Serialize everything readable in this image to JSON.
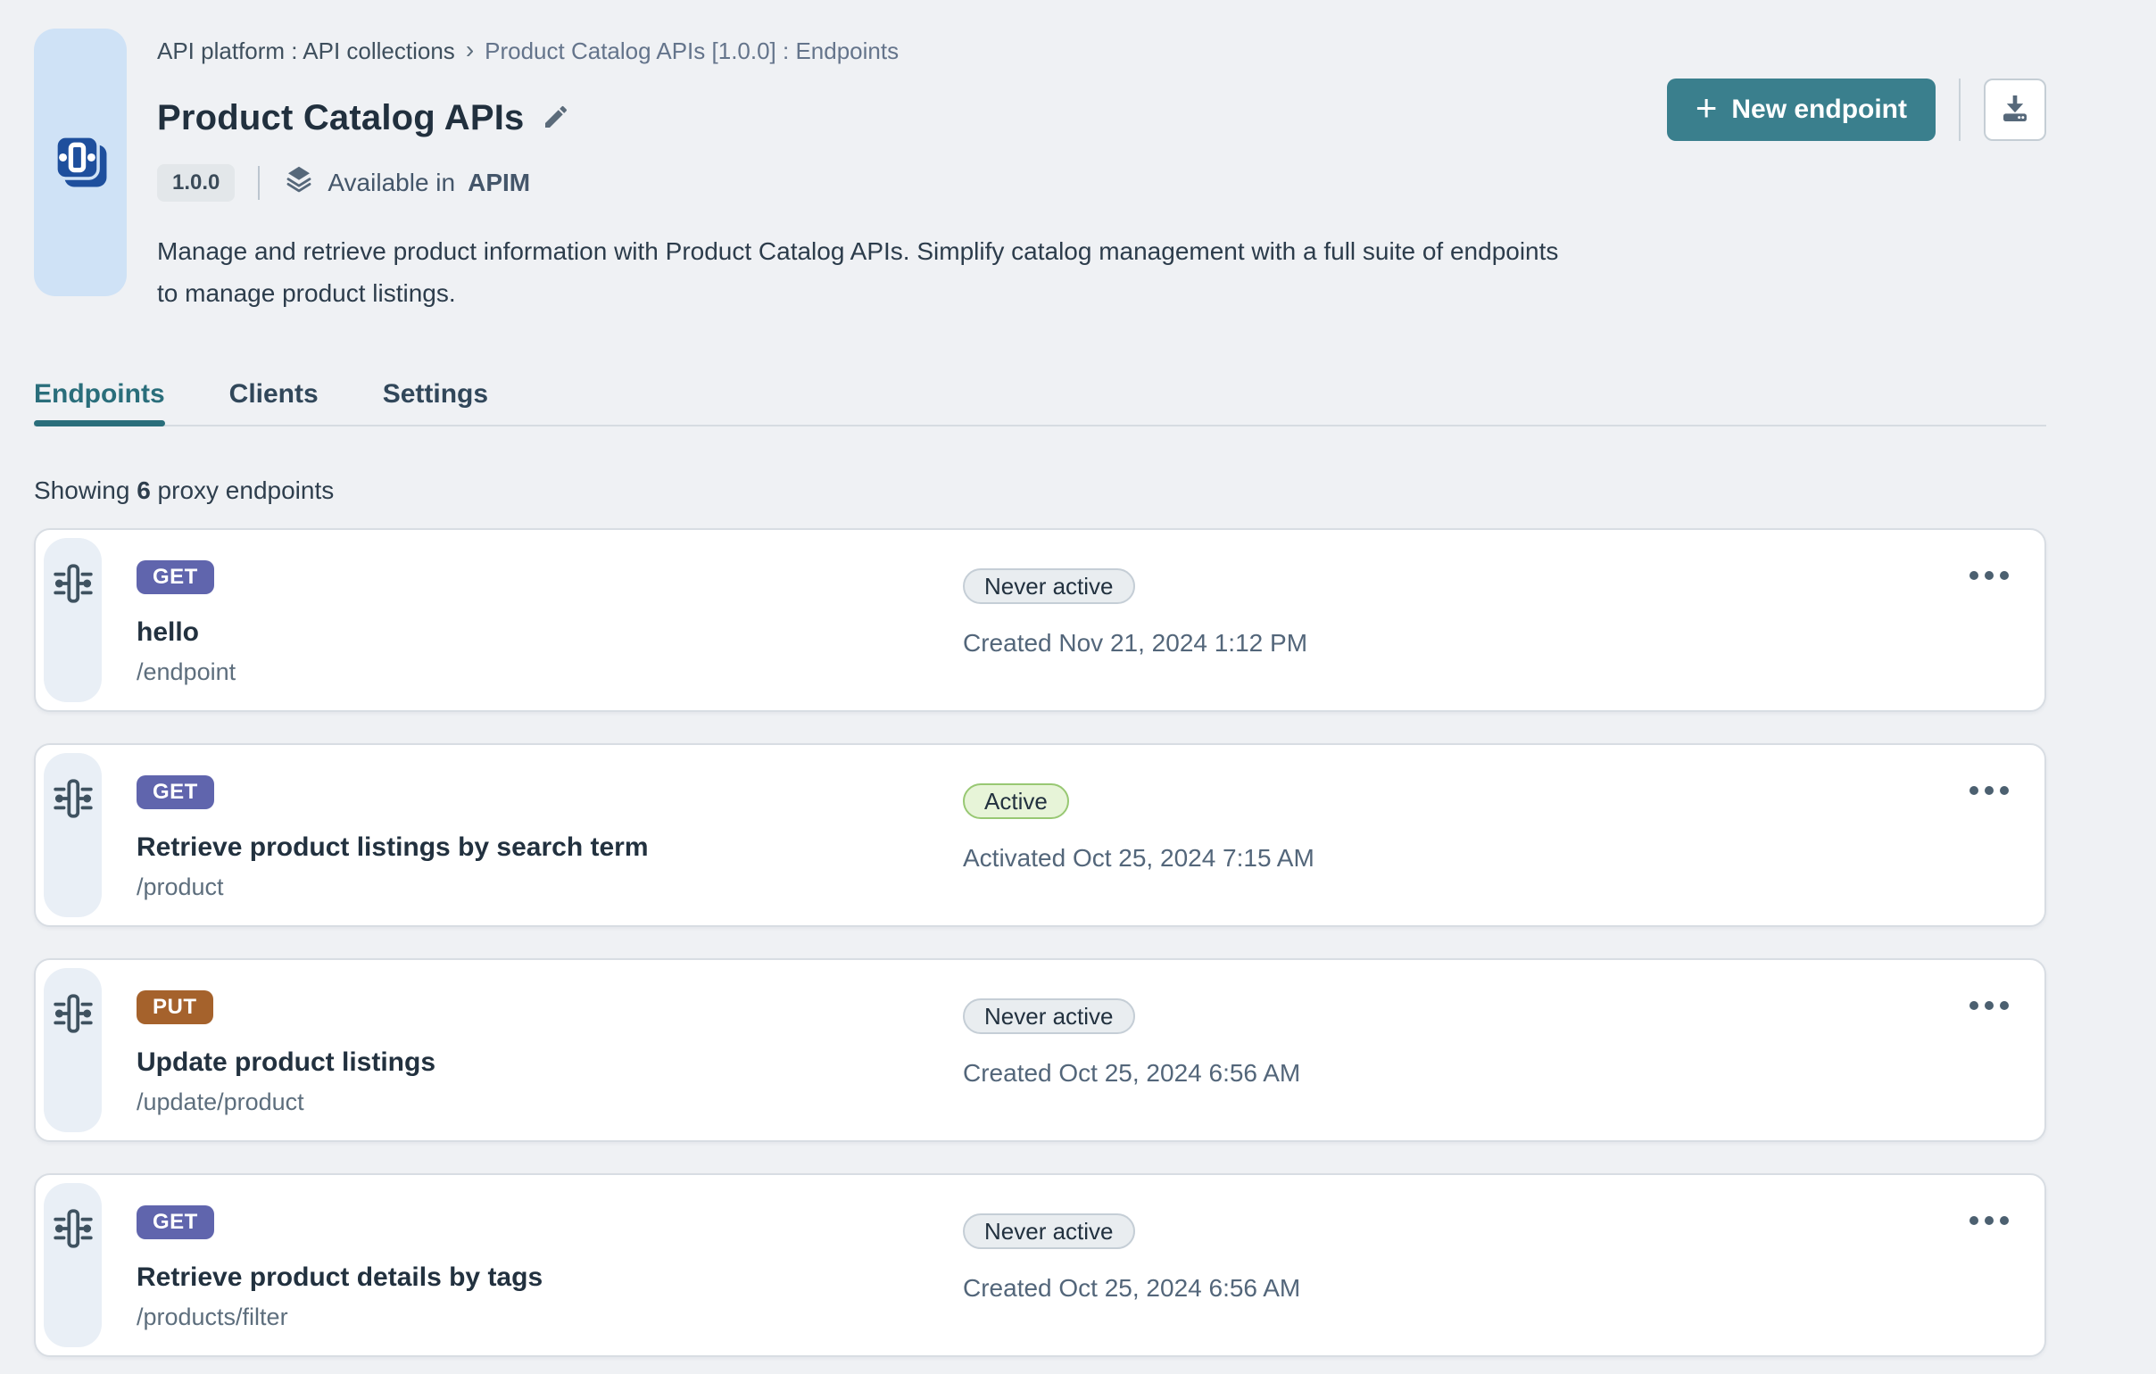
{
  "colors": {
    "accent_teal": "#3a7f8d",
    "tab_active_teal": "#2a6e7b",
    "method_get": "#6065ad",
    "method_put": "#a5622c",
    "status_active_bg": "#e7f4d8",
    "status_active_border": "#98c873",
    "status_neutral_bg": "#e9edf0",
    "tile_bg": "#cfe2f6",
    "tile_icon_blue": "#1e4f9d",
    "page_bg": "#eff1f4"
  },
  "header": {
    "breadcrumb": {
      "primary": "API platform : API collections",
      "separator": "›",
      "secondary": "Product Catalog APIs [1.0.0] : Endpoints"
    },
    "title": "Product Catalog APIs",
    "version": "1.0.0",
    "availability_prefix": "Available in",
    "availability_target": "APIM",
    "description": "Manage and retrieve product information with Product Catalog APIs. Simplify catalog management with a full suite of endpoints to manage product listings.",
    "actions": {
      "plus_glyph": "+",
      "new_endpoint_label": "New endpoint"
    }
  },
  "tabs": [
    {
      "label": "Endpoints",
      "active": true
    },
    {
      "label": "Clients",
      "active": false
    },
    {
      "label": "Settings",
      "active": false
    }
  ],
  "listing": {
    "prefix": "Showing",
    "count": "6",
    "suffix": "proxy endpoints"
  },
  "endpoints": [
    {
      "method": "GET",
      "name": "hello",
      "path": "/endpoint",
      "status": "Never active",
      "status_type": "neutral",
      "timestamp": "Created Nov 21, 2024 1:12 PM"
    },
    {
      "method": "GET",
      "name": "Retrieve product listings by search term",
      "path": "/product",
      "status": "Active",
      "status_type": "active",
      "timestamp": "Activated Oct 25, 2024 7:15 AM"
    },
    {
      "method": "PUT",
      "name": "Update product listings",
      "path": "/update/product",
      "status": "Never active",
      "status_type": "neutral",
      "timestamp": "Created Oct 25, 2024 6:56 AM"
    },
    {
      "method": "GET",
      "name": "Retrieve product details by tags",
      "path": "/products/filter",
      "status": "Never active",
      "status_type": "neutral",
      "timestamp": "Created Oct 25, 2024 6:56 AM"
    }
  ]
}
